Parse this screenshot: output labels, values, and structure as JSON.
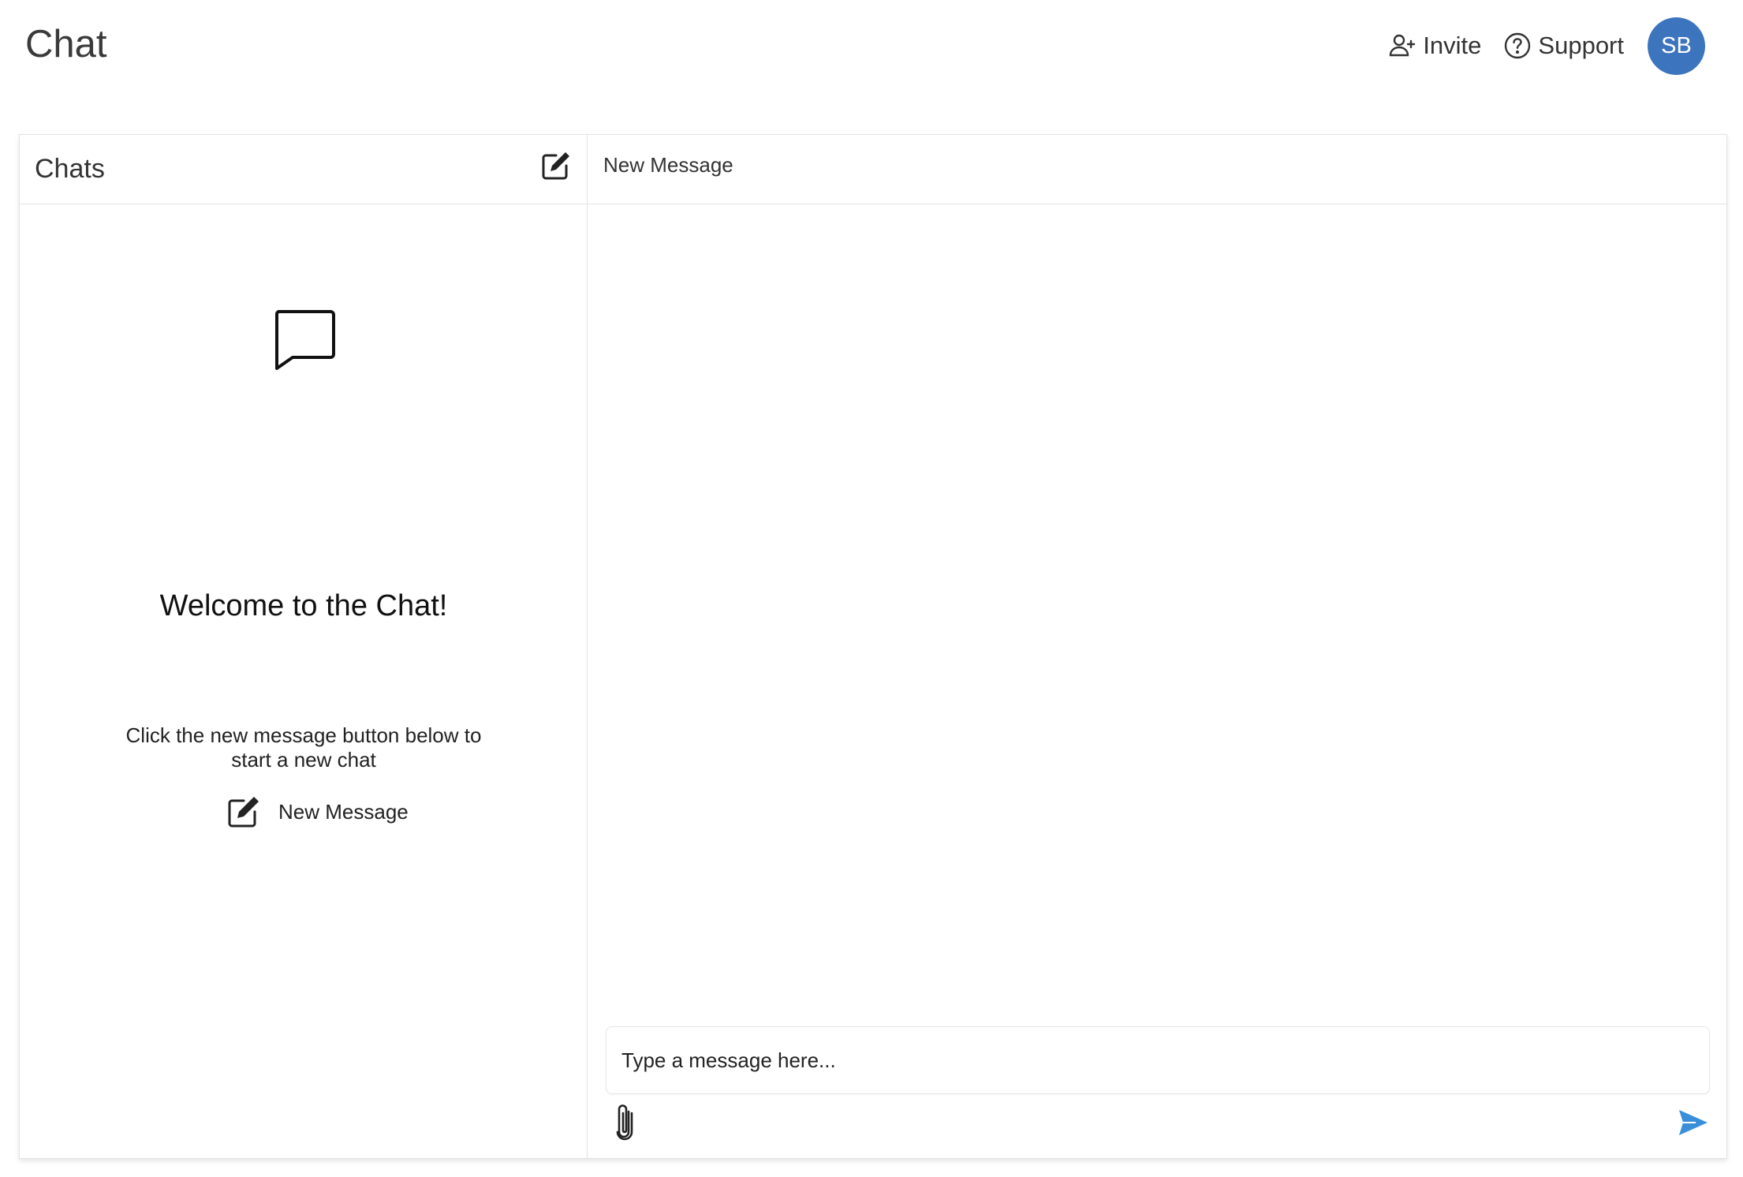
{
  "header": {
    "title": "Chat",
    "invite_label": "Invite",
    "support_label": "Support",
    "avatar_initials": "SB",
    "avatar_color": "#3d74be"
  },
  "sidebar": {
    "title": "Chats",
    "compose_icon": "compose-icon"
  },
  "empty_state": {
    "icon": "chat-bubble-icon",
    "welcome": "Welcome to the Chat!",
    "hint": "Click the new message button below to start a new chat",
    "new_message_label": "New Message"
  },
  "conversation": {
    "title": "New Message",
    "input_placeholder": "Type a message here...",
    "attach_icon": "paperclip-icon",
    "send_icon": "send-icon",
    "send_color": "#3a8fd9"
  }
}
